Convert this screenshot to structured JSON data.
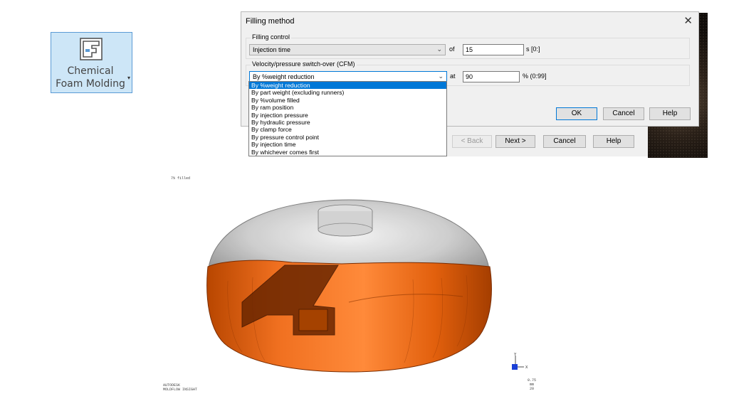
{
  "ribbon": {
    "label_line1": "Chemical",
    "label_line2": "Foam Molding",
    "icon": "chemical-foam-molding-icon"
  },
  "wizard": {
    "back": "< Back",
    "next": "Next >",
    "cancel": "Cancel",
    "help": "Help"
  },
  "dialog": {
    "title": "Filling method",
    "close": "✕",
    "filling_control": {
      "group_title": "Filling control",
      "selected": "Injection time",
      "of_label": "of",
      "value": "15",
      "unit": "s [0:]"
    },
    "switch_over": {
      "group_title": "Velocity/pressure switch-over (CFM)",
      "selected": "By %weight reduction",
      "at_label": "at",
      "value": "90",
      "unit": "% (0:99]"
    },
    "buttons": {
      "ok": "OK",
      "cancel": "Cancel",
      "help": "Help"
    },
    "options": [
      "By %weight reduction",
      "By part weight (excluding runners)",
      "By %volume filled",
      "By ram position",
      "By injection pressure",
      "By hydraulic pressure",
      "By clamp force",
      "By pressure control point",
      "By injection time",
      "By whichever comes first"
    ]
  },
  "viewport": {
    "top_left_text": "7% filled",
    "bottom_left_text_1": "AUTODESK",
    "bottom_left_text_2": "MOLDFLOW INSIGHT",
    "scale_line1": "0.75",
    "scale_line2": "mm",
    "scale_line3": "20",
    "axis_y": "Y",
    "axis_x": "X",
    "colors": {
      "filled": "#e8620f",
      "unfilled": "#bdbdbd"
    }
  }
}
